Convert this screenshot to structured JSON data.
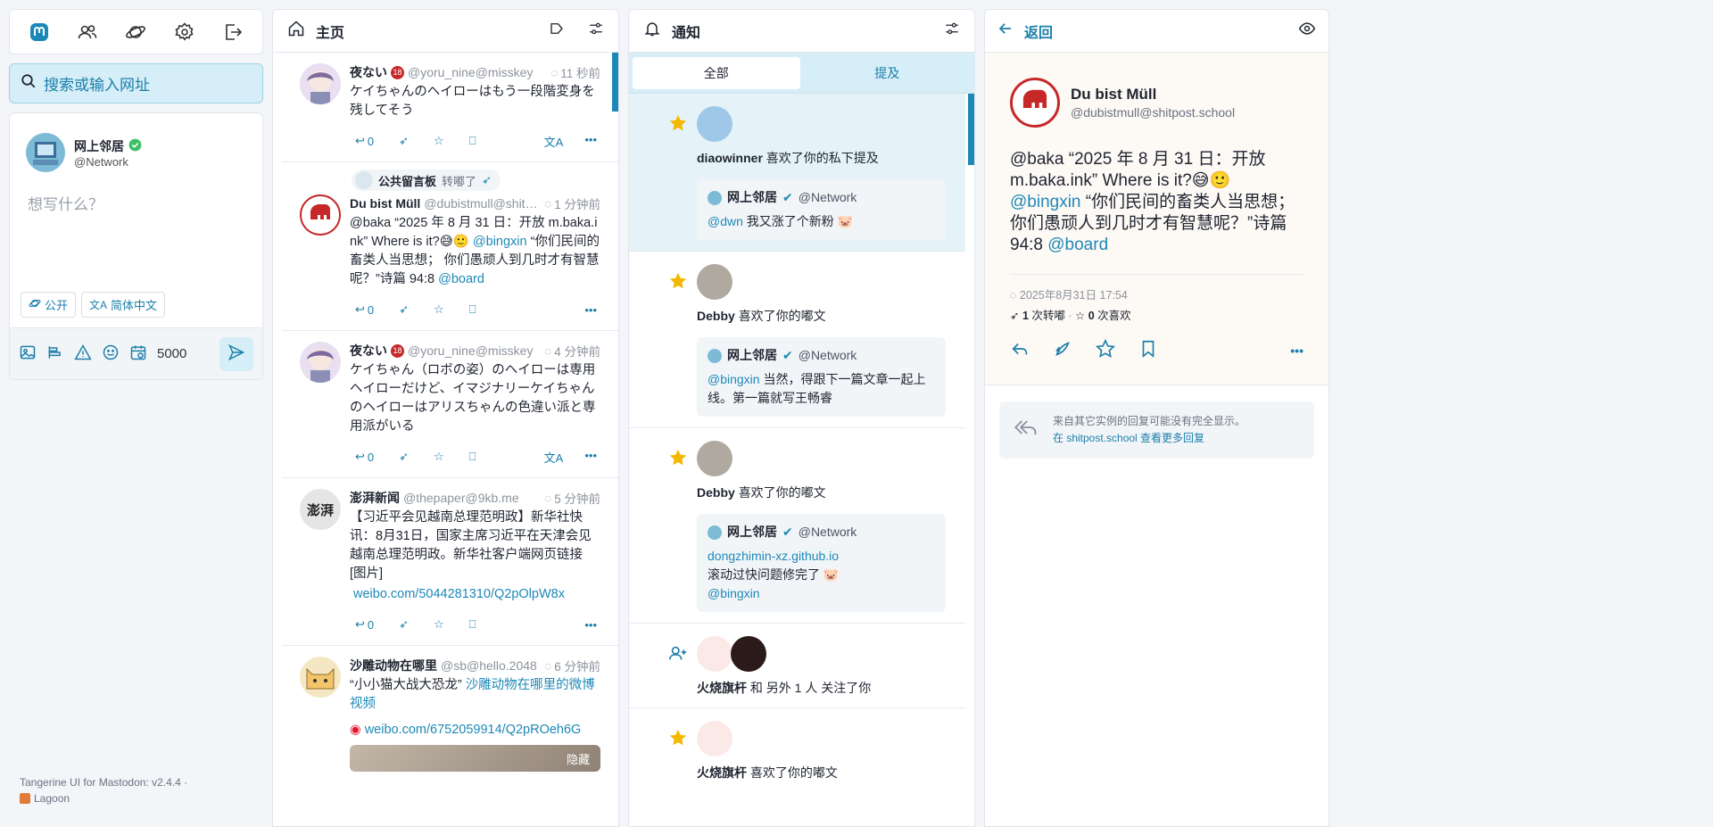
{
  "nav": {
    "icons": [
      "mastodon-logo-icon",
      "people-icon",
      "planet-icon",
      "gear-icon",
      "logout-icon"
    ]
  },
  "search": {
    "placeholder": "搜索或输入网址"
  },
  "compose": {
    "display_name": "网上邻居",
    "acct": "@Network",
    "placeholder": "想写什么？",
    "visibility": "公开",
    "language": "简体中文",
    "char_count": "5000"
  },
  "footer": {
    "line1": "Tangerine UI for Mastodon: v2.4.4 ·",
    "line2": "Lagoon"
  },
  "home": {
    "title": "主页",
    "statuses": [
      {
        "name": "夜ない",
        "acct": "@yoru_nine@misskey",
        "time": "11 秒前",
        "text": "ケイちゃんのヘイローはもう一段階変身を残してそう",
        "replies": "0"
      },
      {
        "boost_by": "公共留言板",
        "boost_label": "转嘟了",
        "name": "Du bist Müll",
        "acct": "@dubistmull@shitpost",
        "time": "1 分钟前",
        "text_a": "@baka “2025 年 8 月 31 日：开放 m.baka.ink” Where is it?😅🙂 ",
        "mention": "@bingxin",
        "text_b": " “你们民间的畜类人当思想； 你们愚顽人到几时才有智慧呢？”诗篇 94:8 ",
        "mention2": "@board",
        "replies": "0"
      },
      {
        "name": "夜ない",
        "acct": "@yoru_nine@misskey",
        "time": "4 分钟前",
        "text": "ケイちゃん（ロボの姿）のヘイローは専用ヘイローだけど、イマジナリーケイちゃんのヘイローはアリスちゃんの色違い派と専用派がいる",
        "replies": "0"
      },
      {
        "name": "澎湃新闻",
        "acct": "@thepaper@9kb.me",
        "time": "5 分钟前",
        "text": "【习近平会见越南总理范明政】新华社快讯：8月31日，国家主席习近平在天津会见越南总理范明政。新华社客户端网页链接 [图片]",
        "link": "weibo.com/5044281310/Q2pOlpW8x",
        "replies": "0"
      },
      {
        "name": "沙雕动物在哪里",
        "acct": "@sb@hello.2048",
        "time": "6 分钟前",
        "text": "“小小猫大战大恐龙” ",
        "link_text": "沙雕动物在哪里的微博视频",
        "link": "weibo.com/6752059914/Q2pROeh6G",
        "hide": "隐藏"
      }
    ]
  },
  "notifications": {
    "title": "通知",
    "tabs": [
      "全部",
      "提及"
    ],
    "items": [
      {
        "user": "diaowinner",
        "action": "喜欢了你的私下提及",
        "card_name": "网上邻居",
        "card_acct": "@Network",
        "mention": "@dwn",
        "text": " 我又涨了个新粉 🐷"
      },
      {
        "user": "Debby",
        "action": "喜欢了你的嘟文",
        "card_name": "网上邻居",
        "card_acct": "@Network",
        "mention": "@bingxin",
        "text": " 当然，得跟下一篇文章一起上线。第一篇就写王畅睿"
      },
      {
        "user": "Debby",
        "action": "喜欢了你的嘟文",
        "card_name": "网上邻居",
        "card_acct": "@Network",
        "link": "dongzhimin-xz.github.io",
        "text": "滚动过快问题修完了 🐷",
        "mention": "@bingxin"
      },
      {
        "user": "火烧旗杆",
        "action": "和 另外 1 人 关注了你"
      },
      {
        "user": "火烧旗杆",
        "action": "喜欢了你的嘟文"
      }
    ]
  },
  "detail": {
    "back": "返回",
    "name": "Du bist Müll",
    "acct": "@dubistmull@shitpost.school",
    "text_a": "@baka “2025 年 8 月 31 日：开放 m.baka.ink” Where is it?😅🙂 ",
    "mention": "@bingxin",
    "text_b": " “你们民间的畜类人当思想；你们愚顽人到几时才有智慧呢？”诗篇 94:8 ",
    "mention2": "@board",
    "date": "2025年8月31日 17:54",
    "boosts": "1",
    "boosts_label": "次转嘟",
    "favs": "0",
    "favs_label": "次喜欢",
    "more_line1": "来自其它实例的回复可能没有完全显示。",
    "more_link": "在 shitpost.school 查看更多回复"
  },
  "colors": {
    "accent": "#1d88b7",
    "accent_bg": "#d6eef7",
    "star": "#f5b800"
  }
}
